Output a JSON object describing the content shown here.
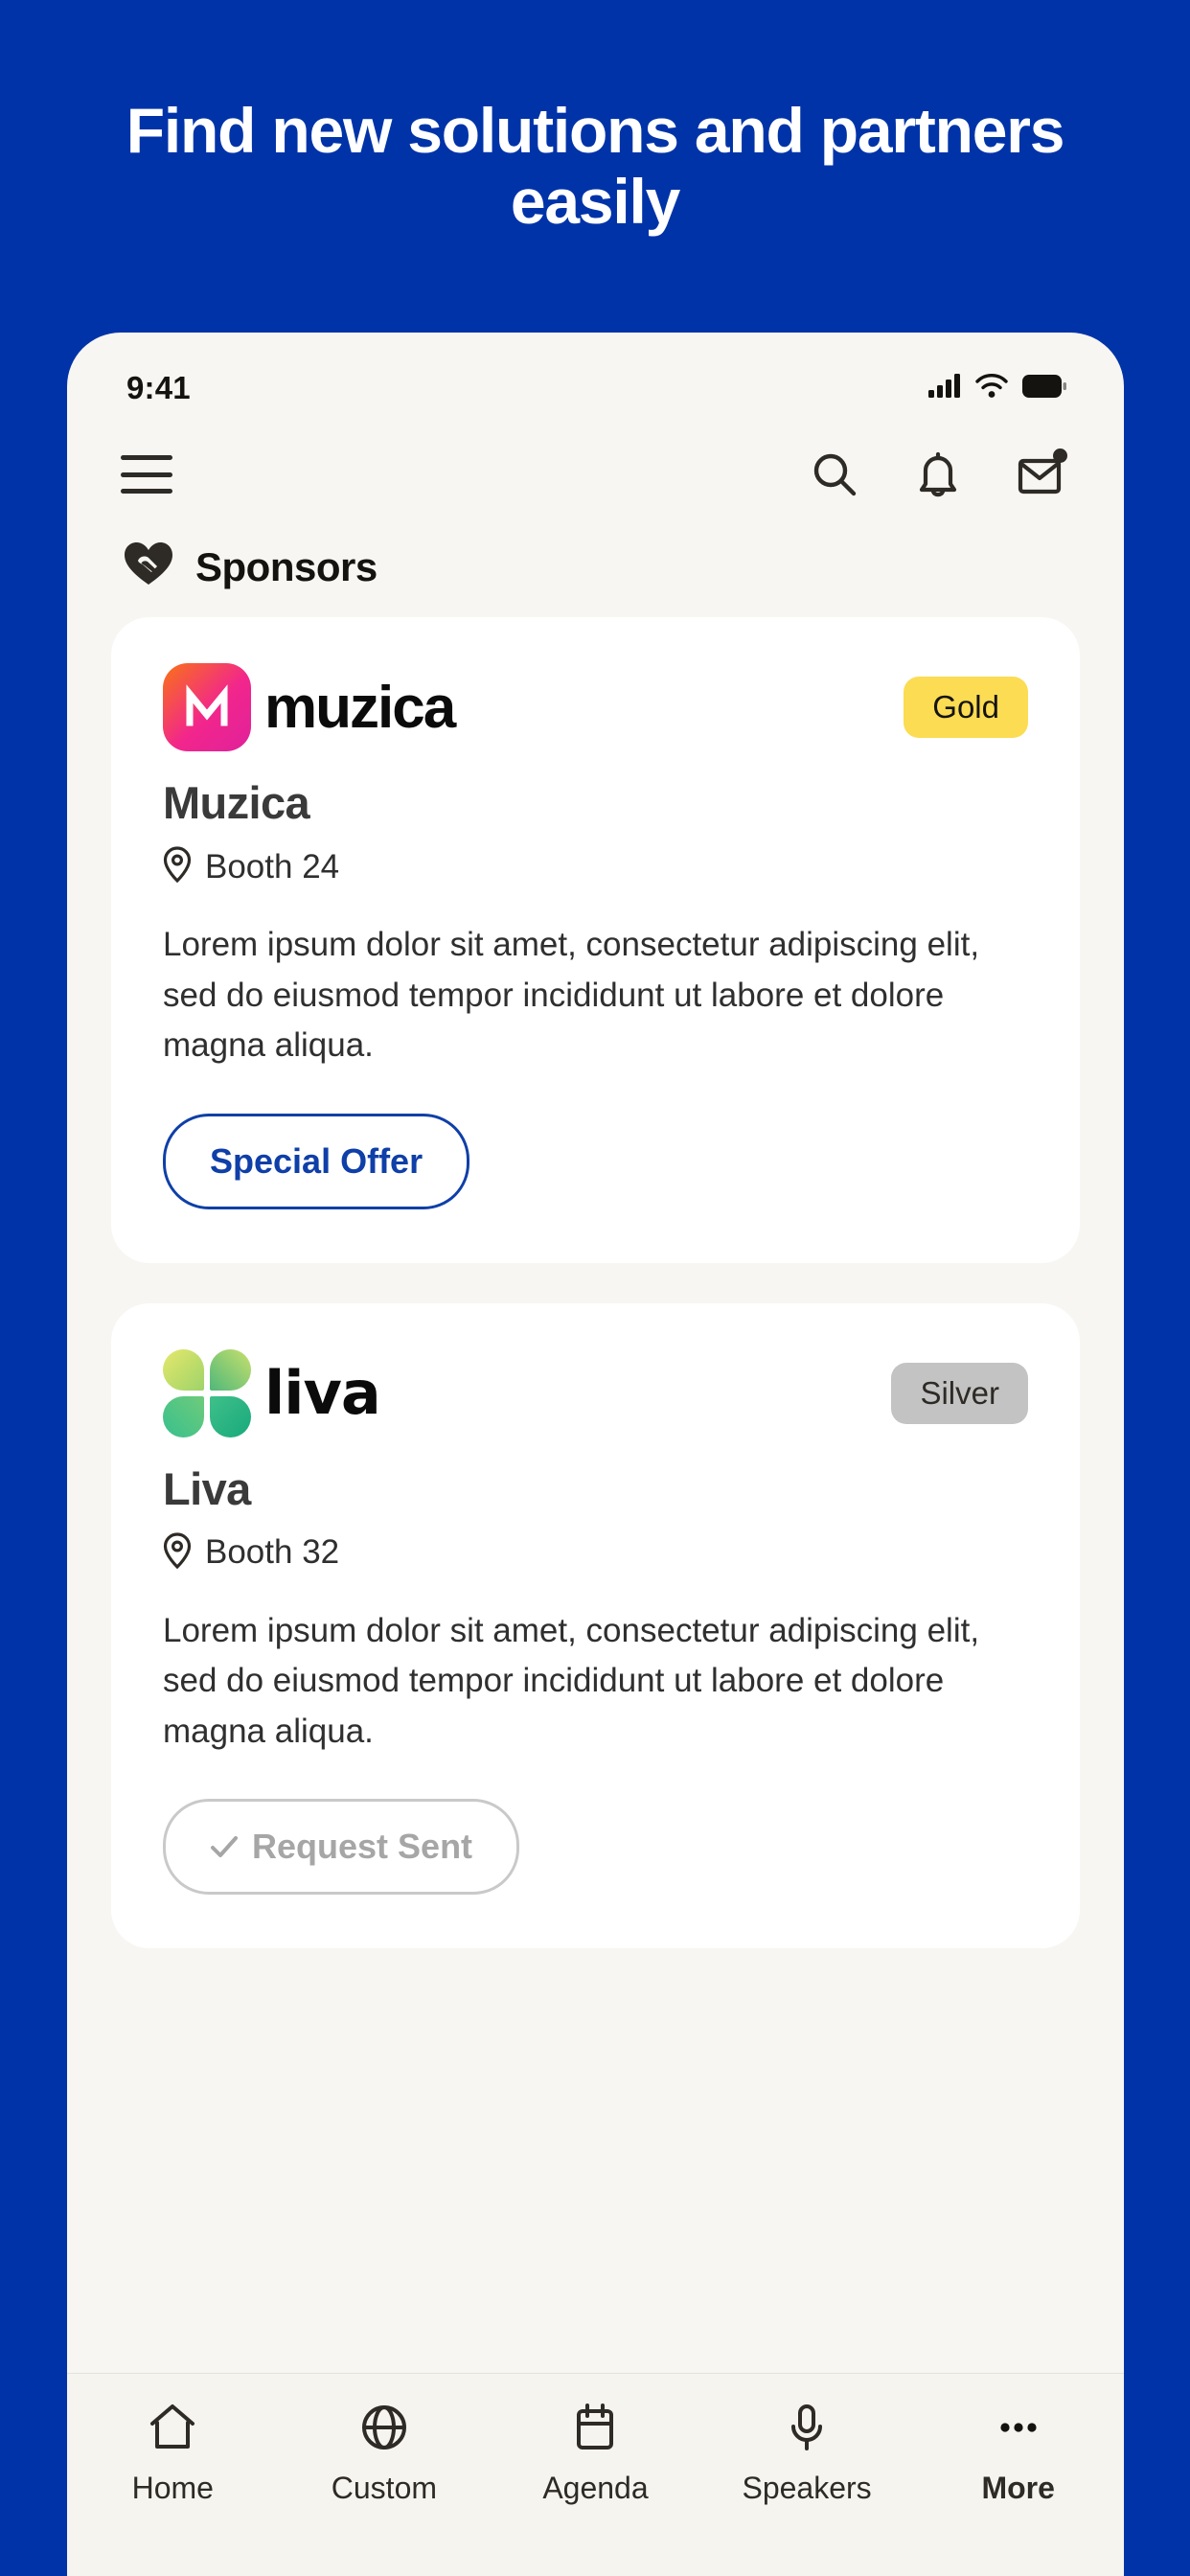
{
  "promo": {
    "headline": "Find new solutions and partners easily",
    "background_color": "#0033A8"
  },
  "status_bar": {
    "time": "9:41",
    "icons": [
      "cellular-signal-icon",
      "wifi-icon",
      "battery-icon"
    ]
  },
  "top_nav": {
    "menu_icon": "hamburger-menu-icon",
    "actions": [
      {
        "name": "search-icon",
        "label": "Search"
      },
      {
        "name": "notifications-icon",
        "label": "Notifications"
      },
      {
        "name": "mail-icon",
        "label": "Messages",
        "has_badge": true
      }
    ]
  },
  "section": {
    "icon": "sponsors-heart-icon",
    "title": "Sponsors"
  },
  "sponsors": [
    {
      "logo_type": "muzica-logo",
      "logo_wordmark": "muzica",
      "tier": "Gold",
      "tier_color": "#FBDC53",
      "name": "Muzica",
      "booth_icon": "location-pin-icon",
      "booth": "Booth 24",
      "description": "Lorem ipsum dolor sit amet, consectetur adipiscing elit, sed do eiusmod tempor incididunt ut labore et dolore magna aliqua.",
      "action_label": "Special Offer",
      "action_style": "outline-primary",
      "action_color": "#0F3FA8"
    },
    {
      "logo_type": "liva-logo",
      "logo_wordmark": "liva",
      "tier": "Silver",
      "tier_color": "#C3C3C3",
      "name": "Liva",
      "booth_icon": "location-pin-icon",
      "booth": "Booth 32",
      "description": "Lorem ipsum dolor sit amet, consectetur adipiscing elit, sed do eiusmod tempor incididunt ut labore et dolore magna aliqua.",
      "action_label": "Request Sent",
      "action_style": "outline-muted",
      "action_color": "#A6A6A6"
    }
  ],
  "tab_bar": [
    {
      "icon": "home-icon",
      "label": "Home",
      "active": false
    },
    {
      "icon": "globe-icon",
      "label": "Custom",
      "active": false
    },
    {
      "icon": "calendar-icon",
      "label": "Agenda",
      "active": false
    },
    {
      "icon": "microphone-icon",
      "label": "Speakers",
      "active": false
    },
    {
      "icon": "more-ellipsis-icon",
      "label": "More",
      "active": true
    }
  ]
}
